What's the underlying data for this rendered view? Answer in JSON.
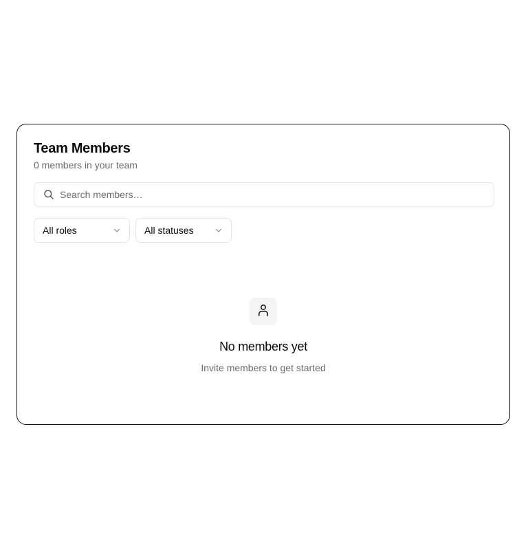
{
  "header": {
    "title": "Team Members",
    "subtitle": "0 members in your team"
  },
  "search": {
    "placeholder": "Search members…",
    "value": "",
    "icon": "search-icon"
  },
  "filters": {
    "role": {
      "selected": "All roles",
      "icon": "chevron-down-icon"
    },
    "status": {
      "selected": "All statuses",
      "icon": "chevron-down-icon"
    }
  },
  "empty_state": {
    "icon": "user-icon",
    "title": "No members yet",
    "description": "Invite members to get started"
  }
}
